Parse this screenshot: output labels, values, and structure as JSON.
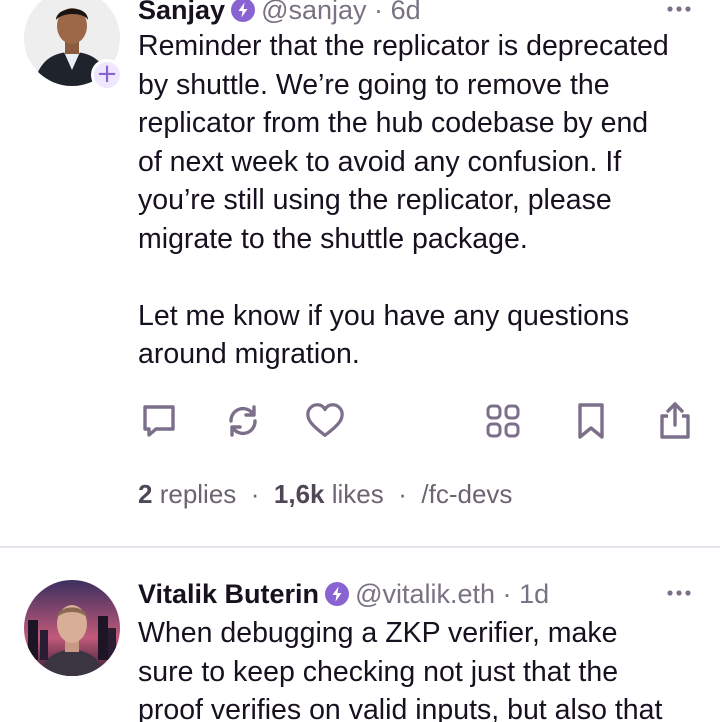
{
  "casts": [
    {
      "display_name": "Sanjay",
      "username": "@sanjay",
      "separator": "·",
      "timestamp": "6d",
      "text": "Reminder that the replicator is deprecated\nby shuttle. We’re going to remove the\nreplicator from the hub codebase by end\nof next week to avoid any confusion. If\nyou’re still using the replicator, please\nmigrate to the shuttle package.\n\nLet me know if you have any questions\naround migration.",
      "follow_badge": "+",
      "stats": {
        "replies_count": "2",
        "replies_label": "replies",
        "likes_count": "1,6k",
        "likes_label": "likes",
        "channel": "/fc-devs",
        "sep": "·"
      },
      "icons": [
        "power-badge-icon",
        "more-icon",
        "reply-icon",
        "recast-icon",
        "like-icon",
        "apps-icon",
        "bookmark-icon",
        "share-icon"
      ]
    },
    {
      "display_name": "Vitalik Buterin",
      "username": "@vitalik.eth",
      "separator": "·",
      "timestamp": "1d",
      "text": "When debugging a ZKP verifier, make\nsure to keep checking not just that the\nproof verifies on valid inputs, but also that",
      "icons": [
        "power-badge-icon",
        "more-icon"
      ]
    }
  ],
  "colors": {
    "accent": "#8a63d2",
    "text": "#17101f",
    "muted": "#7a7183",
    "icon": "#7c6f8a",
    "divider": "#e6e4ea"
  }
}
